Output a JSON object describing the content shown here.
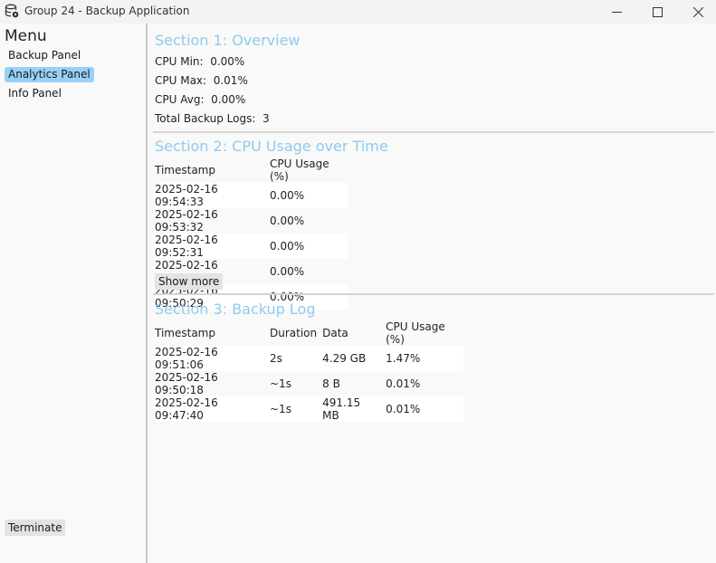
{
  "window": {
    "title": "Group 24 - Backup Application",
    "icon": "database-gear-icon",
    "controls": {
      "minimize": "—",
      "maximize": "☐",
      "close": "✕"
    }
  },
  "sidebar": {
    "title": "Menu",
    "items": [
      {
        "label": "Backup Panel",
        "active": false
      },
      {
        "label": "Analytics Panel",
        "active": true
      },
      {
        "label": "Info Panel",
        "active": false
      }
    ],
    "terminate_label": "Terminate"
  },
  "section1": {
    "title": "Section 1: Overview",
    "stats": [
      {
        "label": "CPU Min:",
        "value": "0.00%"
      },
      {
        "label": "CPU Max:",
        "value": "0.01%"
      },
      {
        "label": "CPU Avg:",
        "value": "0.00%"
      },
      {
        "label": "Total Backup Logs:",
        "value": "3"
      }
    ]
  },
  "section2": {
    "title": "Section 2: CPU Usage over Time",
    "headers": [
      "Timestamp",
      "CPU Usage (%)"
    ],
    "rows": [
      [
        "2025-02-16 09:54:33",
        "0.00%"
      ],
      [
        "2025-02-16 09:53:32",
        "0.00%"
      ],
      [
        "2025-02-16 09:52:31",
        "0.00%"
      ],
      [
        "2025-02-16 09:51:30",
        "0.00%"
      ],
      [
        "2025-02-16 09:50:29",
        "0.00%"
      ]
    ],
    "show_more_label": "Show more"
  },
  "section3": {
    "title": "Section 3: Backup Log",
    "headers": [
      "Timestamp",
      "Duration",
      "Data",
      "CPU Usage (%)"
    ],
    "rows": [
      [
        "2025-02-16 09:51:06",
        "2s",
        "4.29 GB",
        "1.47%"
      ],
      [
        "2025-02-16 09:50:18",
        "~1s",
        "8 B",
        "0.01%"
      ],
      [
        "2025-02-16 09:47:40",
        "~1s",
        "491.15 MB",
        "0.01%"
      ]
    ]
  },
  "colors": {
    "section_title": "#8ecbef",
    "active_menu": "#99d0f7",
    "button_bg": "#e3e3e3"
  }
}
